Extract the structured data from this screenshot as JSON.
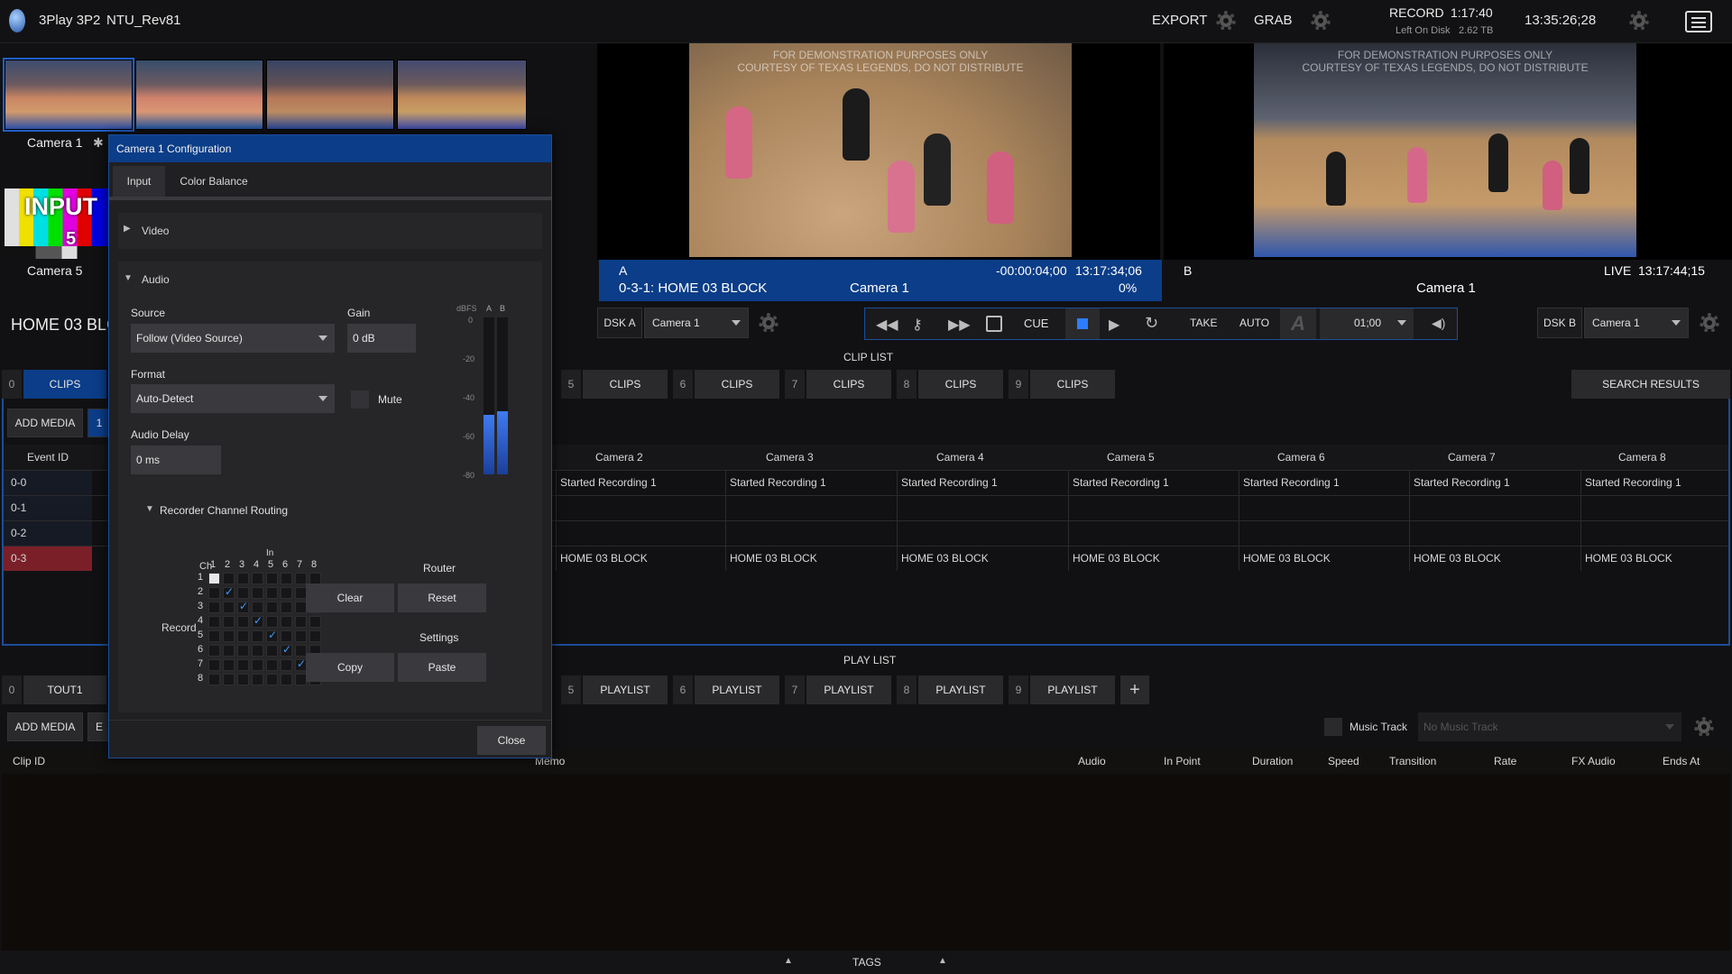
{
  "app": {
    "name": "3Play 3P2",
    "session": "NTU_Rev81",
    "export_label": "EXPORT",
    "grab_label": "GRAB",
    "record_label": "RECORD",
    "record_time": "1:17:40",
    "left_on_disk_label": "Left On Disk",
    "left_on_disk_value": "2.62 TB",
    "clock": "13:35:26;28"
  },
  "inputs": {
    "camera1_label": "Camera 1",
    "camera5_label": "Camera 5",
    "input5_text": "INPUT",
    "input5_num": "5"
  },
  "monitor_a": {
    "watermark_line1": "FOR DEMONSTRATION PURPOSES ONLY",
    "watermark_line2": "COURTESY OF TEXAS LEGENDS, DO NOT DISTRIBUTE",
    "letter": "A",
    "timecode": "-00:00:04;00",
    "tc2": "13:17:34;06",
    "clip_name": "0-3-1: HOME 03 BLOCK",
    "camera": "Camera 1",
    "percent": "0%"
  },
  "monitor_b": {
    "watermark_line1": "FOR DEMONSTRATION PURPOSES ONLY",
    "watermark_line2": "COURTESY OF TEXAS LEGENDS, DO NOT DISTRIBUTE",
    "letter": "B",
    "live": "LIVE",
    "timecode": "13:17:44;15",
    "camera": "Camera 1"
  },
  "left_panel_title": "HOME 03 BLC",
  "transport": {
    "dsk_a": "DSK A",
    "dsk_a_source": "Camera 1",
    "cue": "CUE",
    "take": "TAKE",
    "auto": "AUTO",
    "duration": "01;00",
    "dsk_b": "DSK B",
    "dsk_b_source": "Camera 1"
  },
  "clip_list": {
    "title": "CLIP LIST",
    "tabs": [
      {
        "num": "0",
        "label": "CLIPS"
      },
      {
        "num": "5",
        "label": "CLIPS"
      },
      {
        "num": "6",
        "label": "CLIPS"
      },
      {
        "num": "7",
        "label": "CLIPS"
      },
      {
        "num": "8",
        "label": "CLIPS"
      },
      {
        "num": "9",
        "label": "CLIPS"
      }
    ],
    "search_results": "SEARCH RESULTS",
    "add_media": "ADD MEDIA",
    "page_num": "1",
    "event_id_header": "Event ID",
    "camera_headers": [
      "Camera 2",
      "Camera 3",
      "Camera 4",
      "Camera 5",
      "Camera 6",
      "Camera 7",
      "Camera 8"
    ],
    "rows": [
      {
        "id": "0-0",
        "cells": [
          "Started Recording 1",
          "Started Recording 1",
          "Started Recording 1",
          "Started Recording 1",
          "Started Recording 1",
          "Started Recording 1",
          "Started Recording 1"
        ]
      },
      {
        "id": "0-1",
        "cells": [
          "",
          "",
          "",
          "",
          "",
          "",
          ""
        ]
      },
      {
        "id": "0-2",
        "cells": [
          "",
          "",
          "",
          "",
          "",
          "",
          ""
        ]
      },
      {
        "id": "0-3",
        "cells": [
          "HOME 03 BLOCK",
          "HOME 03 BLOCK",
          "HOME 03 BLOCK",
          "HOME 03 BLOCK",
          "HOME 03 BLOCK",
          "HOME 03 BLOCK",
          "HOME 03 BLOCK"
        ]
      }
    ]
  },
  "play_list": {
    "title": "PLAY LIST",
    "tabs": [
      {
        "num": "0",
        "label": "TOUT1"
      },
      {
        "num": "5",
        "label": "PLAYLIST"
      },
      {
        "num": "6",
        "label": "PLAYLIST"
      },
      {
        "num": "7",
        "label": "PLAYLIST"
      },
      {
        "num": "8",
        "label": "PLAYLIST"
      },
      {
        "num": "9",
        "label": "PLAYLIST"
      }
    ],
    "add_media": "ADD MEDIA",
    "e_btn": "E",
    "music_track_label": "Music Track",
    "music_track_placeholder": "No Music Track",
    "headers": {
      "clip_id": "Clip ID",
      "memo": "Memo",
      "audio": "Audio",
      "in_point": "In Point",
      "duration": "Duration",
      "speed": "Speed",
      "transition": "Transition",
      "rate": "Rate",
      "fx_audio": "FX Audio",
      "ends_at": "Ends At"
    }
  },
  "tags_label": "TAGS",
  "dialog": {
    "title": "Camera 1 Configuration",
    "tabs": [
      "Input",
      "Color Balance"
    ],
    "video_section": "Video",
    "audio_section": "Audio",
    "source_label": "Source",
    "source_value": "Follow (Video Source)",
    "gain_label": "Gain",
    "gain_value": "0 dB",
    "format_label": "Format",
    "format_value": "Auto-Detect",
    "mute_label": "Mute",
    "audio_delay_label": "Audio Delay",
    "audio_delay_value": "0 ms",
    "meter_unit": "dBFS",
    "meter_a": "A",
    "meter_b": "B",
    "meter_ticks": [
      "0",
      "-20",
      "-40",
      "-60",
      "-80"
    ],
    "meter_levels": [
      0.38,
      0.4
    ],
    "routing_label": "Recorder Channel Routing",
    "matrix_in_label": "In",
    "matrix_ch_label": "Ch",
    "matrix_record_label": "Record",
    "matrix_cols": [
      "1",
      "2",
      "3",
      "4",
      "5",
      "6",
      "7",
      "8"
    ],
    "matrix_rows": [
      "1",
      "2",
      "3",
      "4",
      "5",
      "6",
      "7",
      "8"
    ],
    "router_label": "Router",
    "clear_btn": "Clear",
    "reset_btn": "Reset",
    "settings_label": "Settings",
    "copy_btn": "Copy",
    "paste_btn": "Paste",
    "close_btn": "Close"
  },
  "colors": {
    "accent_blue": "#0b3d88",
    "selected_row": "#7a1f28",
    "check": "#3b9bff"
  }
}
